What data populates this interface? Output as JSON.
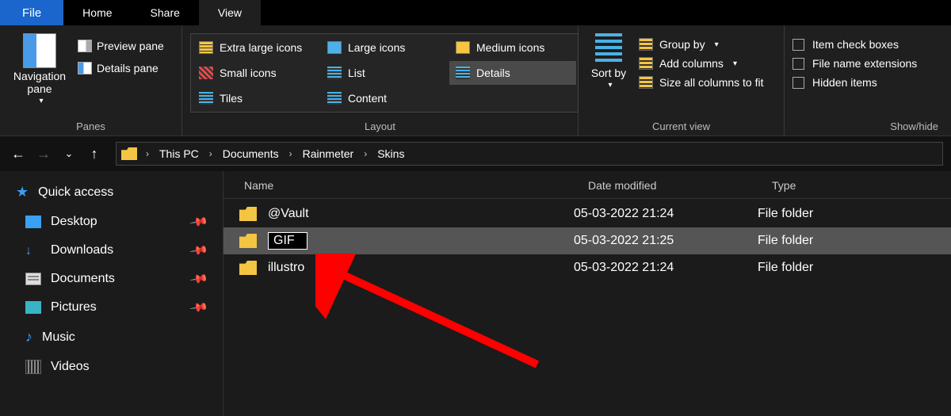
{
  "menu": {
    "file": "File",
    "home": "Home",
    "share": "Share",
    "view": "View"
  },
  "ribbon": {
    "panes": {
      "navPane": "Navigation pane",
      "preview": "Preview pane",
      "details": "Details pane",
      "label": "Panes"
    },
    "layout": {
      "extraLarge": "Extra large icons",
      "large": "Large icons",
      "medium": "Medium icons",
      "small": "Small icons",
      "list": "List",
      "detailsView": "Details",
      "tiles": "Tiles",
      "content": "Content",
      "label": "Layout"
    },
    "currentView": {
      "sortBy": "Sort by",
      "groupBy": "Group by",
      "addColumns": "Add columns",
      "sizeAll": "Size all columns to fit",
      "label": "Current view"
    },
    "showHide": {
      "itemCheck": "Item check boxes",
      "fileExt": "File name extensions",
      "hidden": "Hidden items",
      "label": "Show/hide"
    }
  },
  "breadcrumb": {
    "items": [
      "This PC",
      "Documents",
      "Rainmeter",
      "Skins"
    ]
  },
  "sidebar": {
    "quickAccess": "Quick access",
    "desktop": "Desktop",
    "downloads": "Downloads",
    "documents": "Documents",
    "pictures": "Pictures",
    "music": "Music",
    "videos": "Videos"
  },
  "columns": {
    "name": "Name",
    "date": "Date modified",
    "type": "Type"
  },
  "files": [
    {
      "name": "@Vault",
      "date": "05-03-2022 21:24",
      "type": "File folder",
      "selected": false,
      "editing": false
    },
    {
      "name": "GIF",
      "date": "05-03-2022 21:25",
      "type": "File folder",
      "selected": true,
      "editing": true
    },
    {
      "name": "illustro",
      "date": "05-03-2022 21:24",
      "type": "File folder",
      "selected": false,
      "editing": false
    }
  ],
  "dropdownGlyph": "▾",
  "chevRight": "›"
}
